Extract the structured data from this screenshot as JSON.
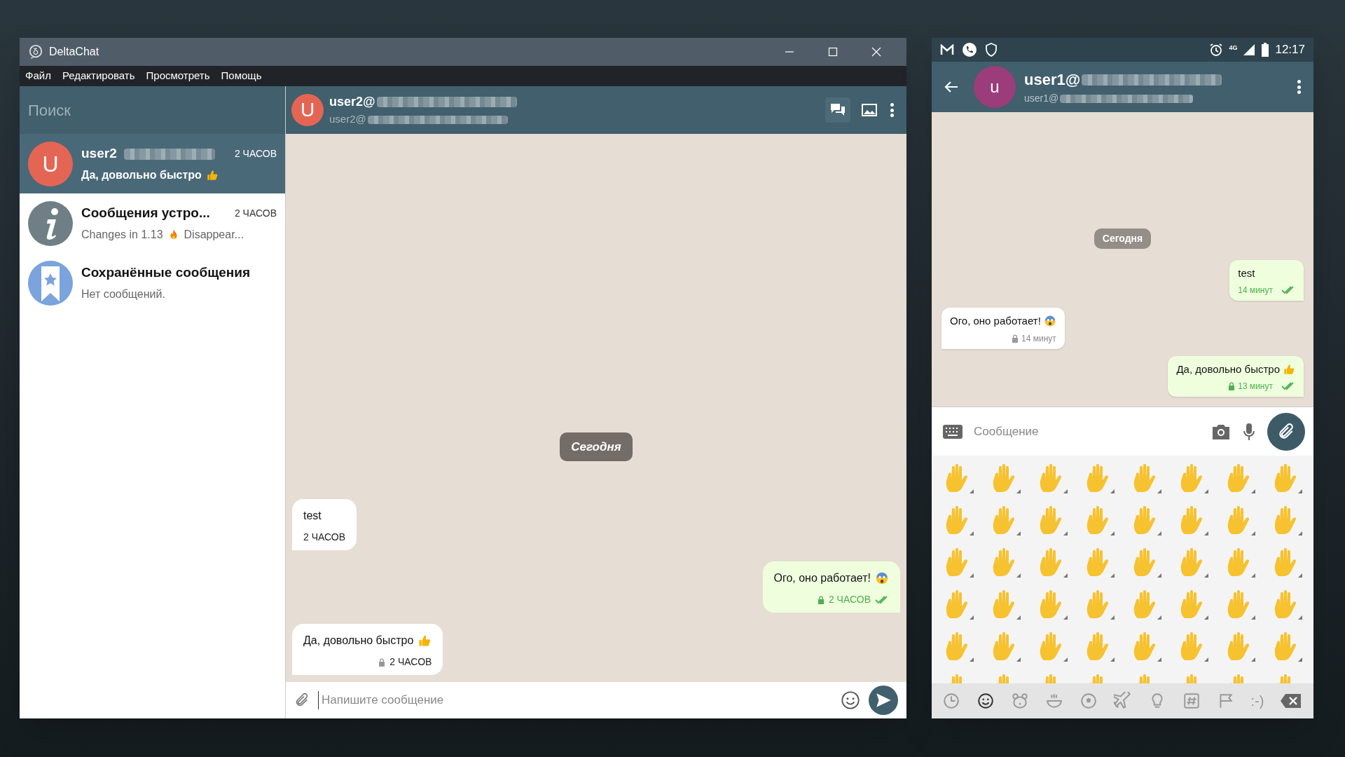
{
  "desktop_app": {
    "window": {
      "title": "DeltaChat"
    },
    "menu": [
      "Файл",
      "Редактировать",
      "Просмотреть",
      "Помощь"
    ],
    "search": {
      "placeholder": "Поиск"
    },
    "chats": [
      {
        "kind": "letter",
        "avatar_letter": "U",
        "name": "user2",
        "blurred": true,
        "time": "2 ЧАСОВ",
        "preview": "Да, довольно быстро",
        "emoji": {
          "kind": "thumbs-up"
        },
        "selected": true
      },
      {
        "kind": "info",
        "name": "Сообщения устро...",
        "time": "2 ЧАСОВ",
        "preview": "Changes in 1.13",
        "emoji": {
          "kind": "fire"
        },
        "preview_after": "Disappear...",
        "selected": false
      },
      {
        "kind": "saved",
        "name": "Сохранённые сообщения",
        "preview": "Нет сообщений.",
        "selected": false
      }
    ],
    "chat": {
      "avatar_letter": "U",
      "title": "user2@",
      "subtitle": "user2@",
      "day": "Сегодня",
      "messages": [
        {
          "kind": "incoming",
          "text": "test",
          "time": "2 ЧАСОВ",
          "encrypted": false
        },
        {
          "kind": "outgoing",
          "text": "Ого, оно работает!",
          "emoji": {
            "kind": "scream"
          },
          "time": "2 ЧАСОВ",
          "encrypted": true,
          "read": true
        },
        {
          "kind": "incoming",
          "text": "Да, довольно быстро",
          "emoji": {
            "kind": "thumbs-up"
          },
          "time": "2 ЧАСОВ",
          "encrypted": true
        }
      ],
      "composer": {
        "placeholder": "Напишите сообщение"
      }
    }
  },
  "phone": {
    "status_bar": {
      "network": "4G",
      "time": "12:17"
    },
    "chat": {
      "avatar_letter": "u",
      "title": "user1@",
      "subtitle": "user1@",
      "day": "Сегодня",
      "messages": [
        {
          "kind": "outgoing",
          "text": "test",
          "time": "14 минут",
          "encrypted": false,
          "read": true
        },
        {
          "kind": "incoming",
          "text": "Ого, оно работает!",
          "emoji": {
            "kind": "scream"
          },
          "time": "14 минут",
          "encrypted": true
        },
        {
          "kind": "outgoing",
          "text": "Да, довольно быстро",
          "emoji": {
            "kind": "thumbs-up"
          },
          "time": "13 минут",
          "encrypted": true,
          "read": true
        }
      ]
    },
    "composer": {
      "placeholder": "Сообщение"
    },
    "emoji_tabs": [
      {
        "kind": "recent",
        "selected": false
      },
      {
        "kind": "smileys",
        "selected": true
      },
      {
        "kind": "animals",
        "selected": false
      },
      {
        "kind": "food",
        "selected": false
      },
      {
        "kind": "sports",
        "selected": false
      },
      {
        "kind": "travel",
        "selected": false
      },
      {
        "kind": "objects",
        "selected": false
      },
      {
        "kind": "symbols",
        "selected": false
      },
      {
        "kind": "flags",
        "selected": false
      },
      {
        "kind": "emoticons",
        "label": ":-)",
        "selected": false
      }
    ]
  }
}
